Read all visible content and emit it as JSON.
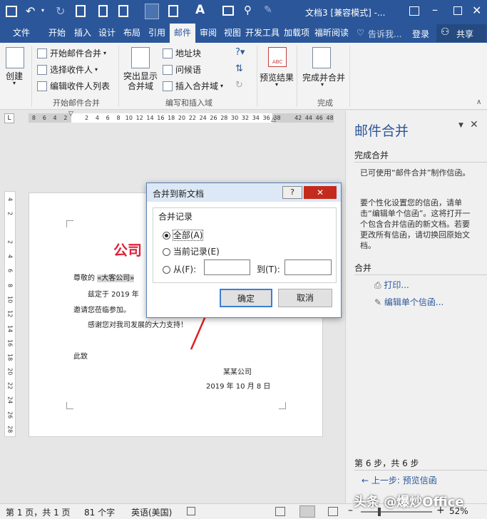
{
  "window": {
    "title": "文档3 [兼容模式] -...",
    "qat_icons": [
      "save-icon",
      "undo-icon",
      "redo-icon",
      "print-preview-icon",
      "new-document-icon",
      "paste-icon",
      "outline-icon",
      "format-painter-icon",
      "font-color-icon",
      "table-icon",
      "find-icon",
      "pen-icon"
    ]
  },
  "tabs": [
    {
      "label": "文件"
    },
    {
      "label": "开始"
    },
    {
      "label": "插入"
    },
    {
      "label": "设计"
    },
    {
      "label": "布局"
    },
    {
      "label": "引用"
    },
    {
      "label": "邮件"
    },
    {
      "label": "审阅"
    },
    {
      "label": "视图"
    },
    {
      "label": "开发工具"
    },
    {
      "label": "加载项"
    },
    {
      "label": "福昕阅读"
    }
  ],
  "tell_me": "告诉我...",
  "signin": "登录",
  "share": "共享",
  "ribbon": {
    "create": {
      "label": "创建"
    },
    "start_merge_group": {
      "label": "开始邮件合并",
      "start_merge": "开始邮件合并",
      "select_recipients": "选择收件人",
      "edit_list": "编辑收件人列表"
    },
    "write_insert_group": {
      "label": "编写和插入域",
      "highlight": "突出显示\n合并域",
      "address_block": "地址块",
      "greeting": "问候语",
      "insert_field": "插入合并域"
    },
    "preview_group": {
      "label": "预览结果",
      "abc": "ABC"
    },
    "finish_group": {
      "label": "完成",
      "finish_merge": "完成并合并"
    }
  },
  "ruler_numbers": [
    "8",
    "6",
    "4",
    "2",
    "",
    "2",
    "4",
    "6",
    "8",
    "10",
    "12",
    "14",
    "16",
    "18",
    "20",
    "22",
    "24",
    "26",
    "28",
    "30",
    "32",
    "34",
    "36",
    "38",
    "",
    "42",
    "44",
    "46",
    "48"
  ],
  "vruler_numbers": [
    "4",
    "2",
    "",
    "2",
    "4",
    "6",
    "8",
    "10",
    "12",
    "14",
    "16",
    "18",
    "20",
    "22",
    "24",
    "26",
    "28"
  ],
  "document": {
    "heading": "公司",
    "line1_prefix": "尊敬的",
    "line1_field": "«大客公司»",
    "line2": "兹定于 2019 年",
    "line3": "邀请您莅临参加。",
    "line4": "感谢您对我司发展的大力支持！",
    "line5": "此致",
    "signature": "某某公司",
    "date": "2019 年 10 月 8 日"
  },
  "pane": {
    "title": "邮件合并",
    "section1_title": "完成合并",
    "section1_text": "已可使用“邮件合并”制作信函。",
    "section1_text2": "要个性化设置您的信函，请单击“编辑单个信函”。这将打开一个包含合并信函的新文档。若要更改所有信函，请切换回原始文档。",
    "section2_title": "合并",
    "print_link": "打印...",
    "edit_link": "编辑单个信函...",
    "step": "第 6 步，共 6 步",
    "prev_link": "上一步: 预览信函"
  },
  "dialog": {
    "title": "合并到新文档",
    "help": "?",
    "group_label": "合并记录",
    "opt_all": "全部(A)",
    "opt_current": "当前记录(E)",
    "opt_from": "从(F):",
    "to_label": "到(T):",
    "from_value": "",
    "to_value": "",
    "ok": "确定",
    "cancel": "取消"
  },
  "status": {
    "page": "第 1 页，共 1 页",
    "words": "81 个字",
    "lang": "英语(美国)",
    "zoom": "52%"
  },
  "watermark": "头条 @爆炒Office"
}
